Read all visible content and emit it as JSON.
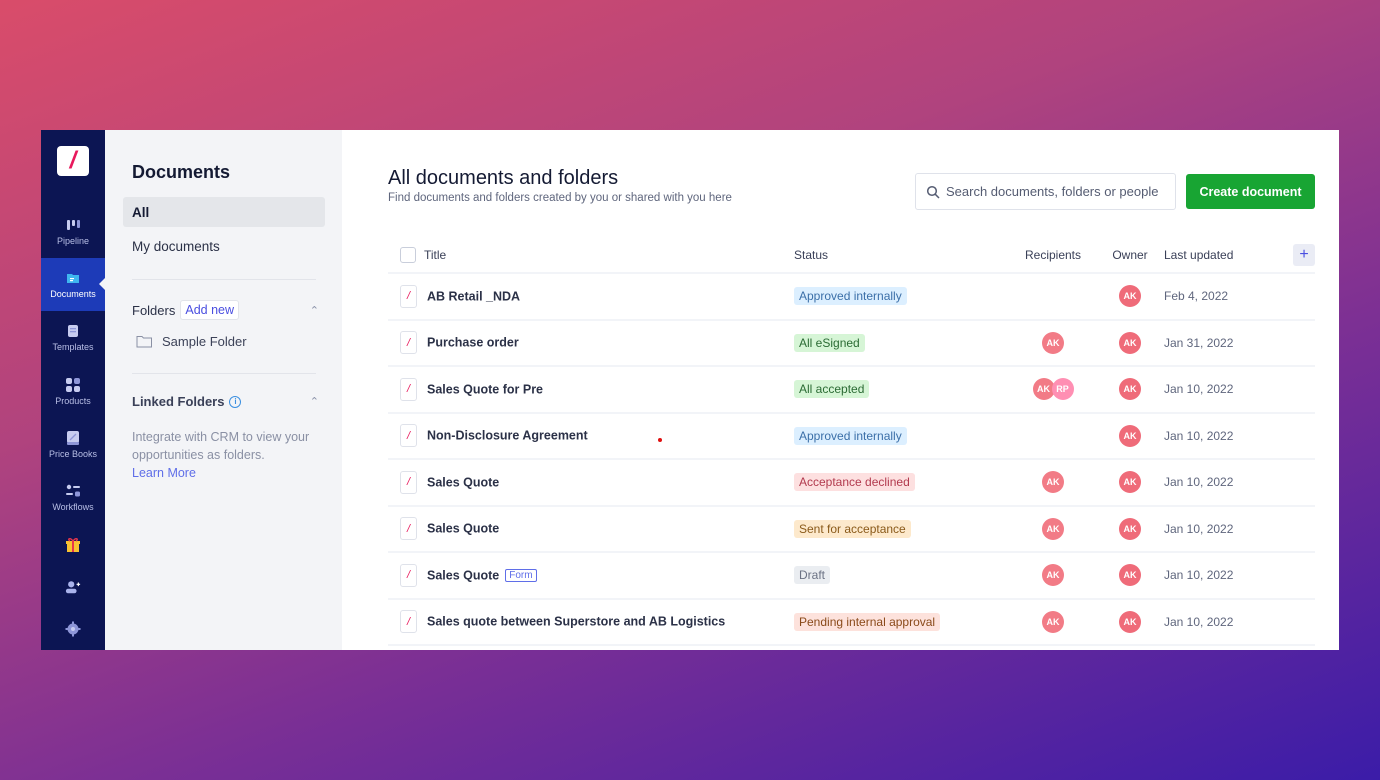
{
  "rail": {
    "logo": "/",
    "items": [
      {
        "label": "Pipeline",
        "icon": "pipeline-icon"
      },
      {
        "label": "Documents",
        "icon": "documents-icon",
        "active": true
      },
      {
        "label": "Templates",
        "icon": "templates-icon"
      },
      {
        "label": "Products",
        "icon": "products-icon"
      },
      {
        "label": "Price Books",
        "icon": "price-books-icon"
      },
      {
        "label": "Workflows",
        "icon": "workflows-icon"
      }
    ],
    "extra_icons": [
      "gift-icon",
      "add-user-icon",
      "settings-icon"
    ]
  },
  "sidebar": {
    "title": "Documents",
    "nav": [
      {
        "label": "All",
        "active": true
      },
      {
        "label": "My documents",
        "active": false
      }
    ],
    "folders": {
      "label": "Folders",
      "add_new": "Add new",
      "items": [
        "Sample Folder"
      ]
    },
    "linked_folders": {
      "label": "Linked Folders",
      "info": "i",
      "description": "Integrate with CRM to view your opportunities as folders.",
      "learn_more": "Learn More"
    }
  },
  "main": {
    "title": "All documents and folders",
    "subtitle": "Find documents and folders created by you or shared with you here",
    "search": {
      "placeholder": "Search documents, folders or people",
      "value": ""
    },
    "create_button": "Create document",
    "columns": [
      "Title",
      "Status",
      "Recipients",
      "Owner",
      "Last updated"
    ],
    "add_column": "+",
    "rows": [
      {
        "title": "AB Retail _NDA",
        "tag": "",
        "status": "Approved internally",
        "status_type": "blue",
        "recipients": [],
        "owner": "AK",
        "updated": "Feb 4, 2022"
      },
      {
        "title": "Purchase order",
        "tag": "",
        "status": "All eSigned",
        "status_type": "green",
        "recipients": [
          "AK"
        ],
        "owner": "AK",
        "updated": "Jan 31, 2022"
      },
      {
        "title": "Sales Quote for Pre",
        "tag": "",
        "status": "All accepted",
        "status_type": "green",
        "recipients": [
          "AK",
          "RP"
        ],
        "owner": "AK",
        "updated": "Jan 10, 2022"
      },
      {
        "title": "Non-Disclosure Agreement",
        "tag": "",
        "status": "Approved internally",
        "status_type": "blue",
        "recipients": [],
        "owner": "AK",
        "updated": "Jan 10, 2022"
      },
      {
        "title": "Sales Quote",
        "tag": "",
        "status": "Acceptance declined",
        "status_type": "red",
        "recipients": [
          "AK"
        ],
        "owner": "AK",
        "updated": "Jan 10, 2022"
      },
      {
        "title": "Sales Quote",
        "tag": "",
        "status": "Sent for acceptance",
        "status_type": "orange",
        "recipients": [
          "AK"
        ],
        "owner": "AK",
        "updated": "Jan 10, 2022"
      },
      {
        "title": "Sales Quote",
        "tag": "Form",
        "status": "Draft",
        "status_type": "gray",
        "recipients": [
          "AK"
        ],
        "owner": "AK",
        "updated": "Jan 10, 2022"
      },
      {
        "title": "Sales quote between Superstore and AB Logistics",
        "tag": "",
        "status": "Pending internal approval",
        "status_type": "peach",
        "recipients": [
          "AK"
        ],
        "owner": "AK",
        "updated": "Jan 10, 2022"
      }
    ]
  },
  "colors": {
    "accent_green": "#18a533",
    "rail_bg": "#0c1553",
    "rail_active": "#1d3bb8",
    "brand_pink": "#e8195c",
    "status": {
      "blue": {
        "bg": "#dcefff",
        "fg": "#3b6fa8"
      },
      "green": {
        "bg": "#d6f5d6",
        "fg": "#2b6b34"
      },
      "red": {
        "bg": "#fde0e0",
        "fg": "#b23a4e"
      },
      "orange": {
        "bg": "#fde9cc",
        "fg": "#8a5a1a"
      },
      "gray": {
        "bg": "#eaedf1",
        "fg": "#6b7284"
      },
      "peach": {
        "bg": "#fde2dc",
        "fg": "#8a4a1a"
      }
    }
  }
}
